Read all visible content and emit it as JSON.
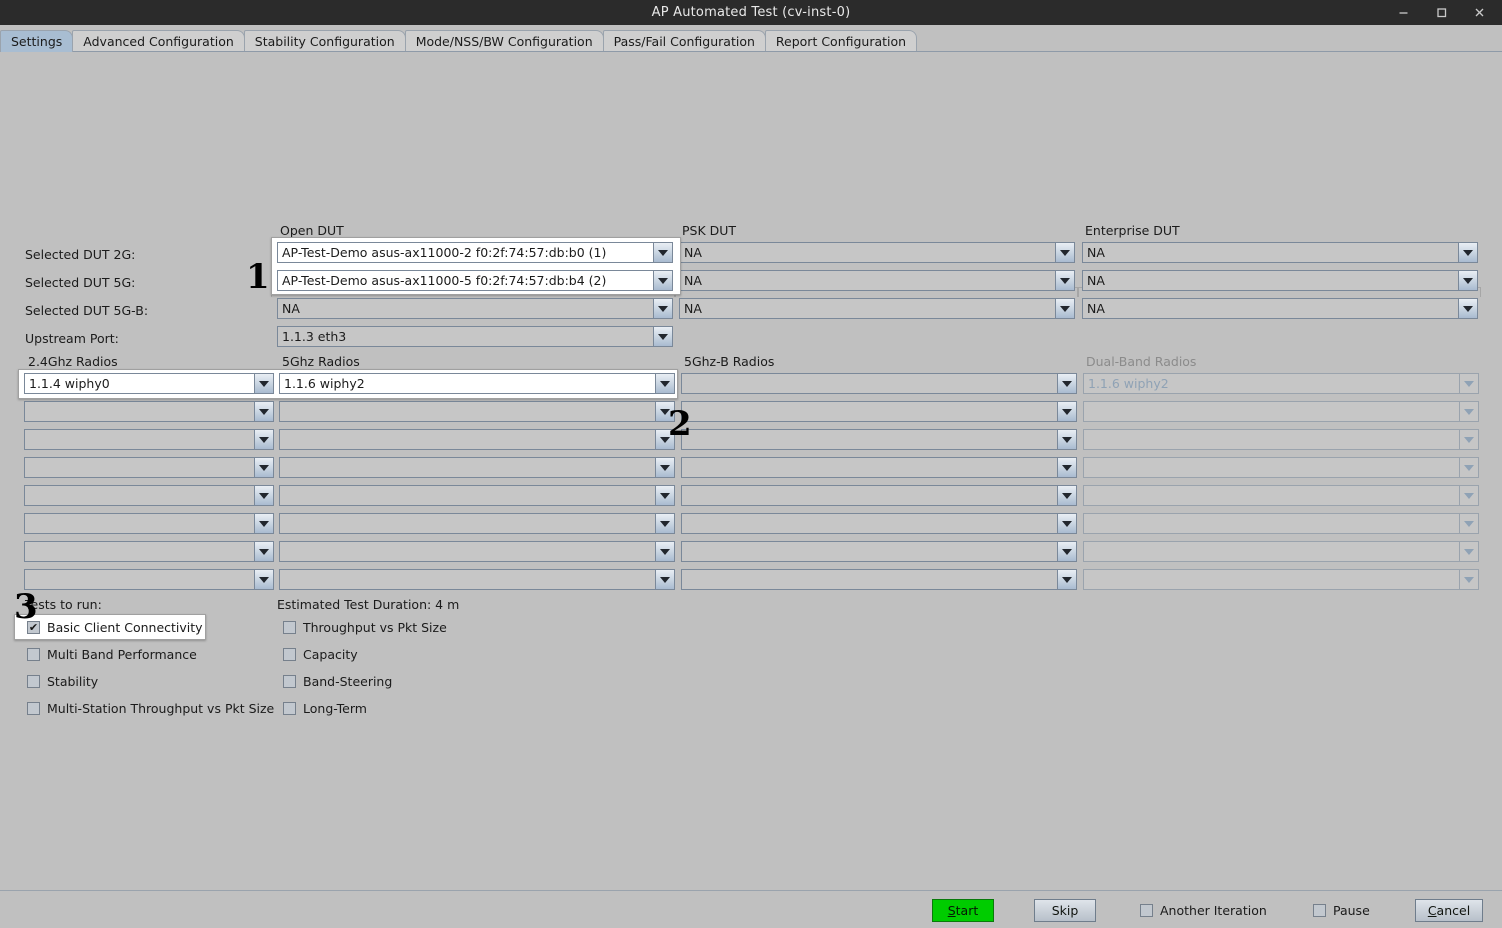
{
  "window": {
    "title": "AP Automated Test  (cv-inst-0)",
    "controls": [
      {
        "name": "minimize",
        "glyph": "minimize-icon"
      },
      {
        "name": "maximize",
        "glyph": "maximize-icon"
      },
      {
        "name": "close",
        "glyph": "close-icon"
      }
    ]
  },
  "tabs": [
    {
      "label": "Settings",
      "active": true
    },
    {
      "label": "Advanced Configuration",
      "active": false
    },
    {
      "label": "Stability Configuration",
      "active": false
    },
    {
      "label": "Mode/NSS/BW Configuration",
      "active": false
    },
    {
      "label": "Pass/Fail Configuration",
      "active": false
    },
    {
      "label": "Report Configuration",
      "active": false
    }
  ],
  "callouts": [
    {
      "number": "1"
    },
    {
      "number": "2"
    },
    {
      "number": "3"
    }
  ],
  "dut": {
    "row_labels": [
      "Selected DUT 2G:",
      "Selected DUT 5G:",
      "Selected DUT 5G-B:",
      "Upstream Port:"
    ],
    "groups": [
      {
        "title": "Open DUT",
        "disabled": false
      },
      {
        "title": "PSK DUT",
        "disabled": false
      },
      {
        "title": "Enterprise DUT",
        "disabled": false
      }
    ],
    "open": [
      "AP-Test-Demo asus-ax11000-2 f0:2f:74:57:db:b0 (1)",
      "AP-Test-Demo asus-ax11000-5 f0:2f:74:57:db:b4 (2)",
      "NA"
    ],
    "psk": [
      "NA",
      "NA",
      "NA"
    ],
    "enterprise": [
      "NA",
      "NA",
      "NA"
    ],
    "upstream_port": "1.1.3 eth3"
  },
  "radios": {
    "columns": [
      {
        "title": "2.4Ghz Radios",
        "disabled": false
      },
      {
        "title": "5Ghz Radios",
        "disabled": false
      },
      {
        "title": "5Ghz-B Radios",
        "disabled": false
      },
      {
        "title": "Dual-Band Radios",
        "disabled": true
      }
    ],
    "rows": 8,
    "values_24": [
      "1.1.4 wiphy0",
      "",
      "",
      "",
      "",
      "",
      "",
      ""
    ],
    "values_5": [
      "1.1.6 wiphy2",
      "",
      "",
      "",
      "",
      "",
      "",
      ""
    ],
    "values_5b": [
      "",
      "",
      "",
      "",
      "",
      "",
      "",
      ""
    ],
    "values_dual": [
      "1.1.6 wiphy2",
      "",
      "",
      "",
      "",
      "",
      "",
      ""
    ]
  },
  "tests": {
    "label": "Tests to run:",
    "duration_label": "Estimated Test Duration: 4 m",
    "left_column": [
      {
        "label": "Basic Client Connectivity",
        "checked": true,
        "highlighted": true
      },
      {
        "label": "Multi Band Performance",
        "checked": false,
        "highlighted": false
      },
      {
        "label": "Stability",
        "checked": false,
        "highlighted": false
      },
      {
        "label": "Multi-Station Throughput vs Pkt Size",
        "checked": false,
        "highlighted": false
      }
    ],
    "right_column": [
      {
        "label": "Throughput vs Pkt Size",
        "checked": false
      },
      {
        "label": "Capacity",
        "checked": false
      },
      {
        "label": "Band-Steering",
        "checked": false
      },
      {
        "label": "Long-Term",
        "checked": false
      }
    ]
  },
  "footer": {
    "start": "Start",
    "start_mnemonic": "S",
    "start_rest": "tart",
    "skip": "Skip",
    "another_iteration": "Another Iteration",
    "another_iteration_checked": false,
    "pause": "Pause",
    "pause_checked": false,
    "cancel_mnemonic": "C",
    "cancel_rest": "ancel",
    "cancel": "Cancel"
  },
  "colors": {
    "window_bg": "#c0c0c0",
    "titlebar_bg": "#2b2b2b",
    "tab_active": "#a8bdd2",
    "start_green": "#00cc00",
    "disabled_text": "#8fa2b5"
  }
}
